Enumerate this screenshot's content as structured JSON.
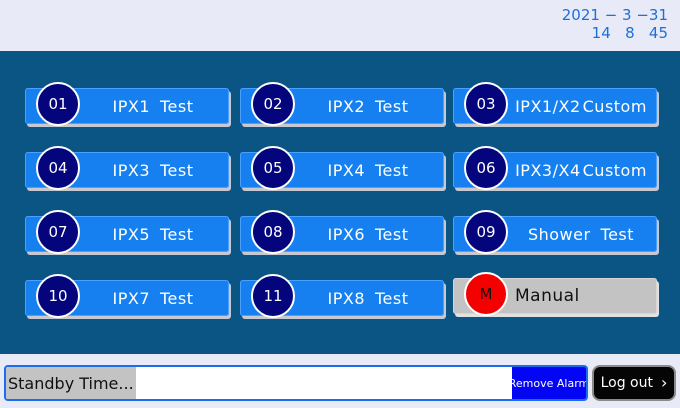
{
  "clock": {
    "date": "2021 − 3 −31",
    "time": "14   8   45"
  },
  "tests": [
    {
      "num": "01",
      "w1": "IPX1",
      "w2": "Test"
    },
    {
      "num": "02",
      "w1": "IPX2",
      "w2": "Test"
    },
    {
      "num": "03",
      "w1": "IPX1/X2",
      "w2": "Custom"
    },
    {
      "num": "04",
      "w1": "IPX3",
      "w2": "Test"
    },
    {
      "num": "05",
      "w1": "IPX4",
      "w2": "Test"
    },
    {
      "num": "06",
      "w1": "IPX3/X4",
      "w2": "Custom"
    },
    {
      "num": "07",
      "w1": "IPX5",
      "w2": "Test"
    },
    {
      "num": "08",
      "w1": "IPX6",
      "w2": "Test"
    },
    {
      "num": "09",
      "w1": "Shower",
      "w2": "Test"
    },
    {
      "num": "10",
      "w1": "IPX7",
      "w2": "Test"
    },
    {
      "num": "11",
      "w1": "IPX8",
      "w2": "Test"
    }
  ],
  "manual": {
    "badge": "M",
    "label": "Manual"
  },
  "footer": {
    "standby": "Standby Time...",
    "remove_alarm": "Remove Alarm",
    "logout": "Log out"
  },
  "colors": {
    "panel": "#0b5584",
    "tile": "#1680f0",
    "circle": "#04047d",
    "manual_badge": "#f50000",
    "alarm": "#0505f5"
  }
}
